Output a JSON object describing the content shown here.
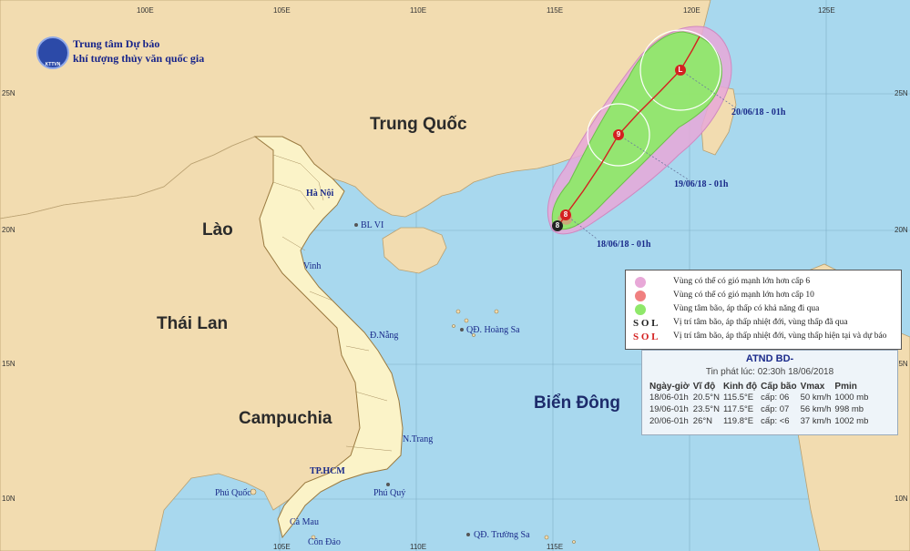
{
  "header": {
    "line1": "Trung tâm Dự báo",
    "line2": "khí tượng thủy văn quốc gia",
    "logo_text": "KTTVN"
  },
  "ticks": {
    "lon": [
      "100E",
      "105E",
      "110E",
      "115E",
      "120E",
      "125E"
    ],
    "lat": [
      "25N",
      "20N",
      "15N",
      "10N"
    ]
  },
  "countries": {
    "china": "Trung Quốc",
    "laos": "Lào",
    "thailand": "Thái Lan",
    "cambodia": "Campuchia"
  },
  "sea": "Biển Đông",
  "places": {
    "hanoi": "Hà Nội",
    "blvi": "BL VI",
    "vinh": "Vinh",
    "danang": "Đ.Nẵng",
    "hoangsa": "QĐ. Hoàng Sa",
    "nhatrang": "N.Trang",
    "hcm": "TP.HCM",
    "phuquoc": "Phú Quốc",
    "phuquy": "Phú Quý",
    "camau": "Cà Mau",
    "condao": "Côn Đảo",
    "truongsa": "QĐ. Trường Sa"
  },
  "forecast_labels": {
    "d1": "18/06/18 - 01h",
    "d2": "19/06/18 - 01h",
    "d3": "20/06/18 - 01h"
  },
  "storm_symbols": {
    "past": "8",
    "current": "8",
    "day2": "9",
    "day3": "L"
  },
  "legend": {
    "items": [
      {
        "text": "Vùng có thể có gió mạnh lớn hơn cấp 6",
        "color": "#e8a8d8"
      },
      {
        "text": "Vùng có thể có gió mạnh lớn hơn cấp 10",
        "color": "#f08080"
      },
      {
        "text": "Vùng tâm bão, áp thấp có khả năng đi qua",
        "color": "#8fe86a"
      },
      {
        "text": "Vị trí tâm bão, áp thấp nhiệt đới, vùng thấp đã qua",
        "color": "#222222"
      },
      {
        "text": "Vị trí tâm bão, áp thấp nhiệt đới, vùng thấp hiện tại và dự báo",
        "color": "#d42020"
      }
    ]
  },
  "info": {
    "title": "ATND BD-",
    "issued": "Tin phát lúc: 02:30h 18/06/2018",
    "columns": [
      "Ngày-giờ",
      "Vĩ độ",
      "Kinh độ",
      "Cấp bão",
      "Vmax",
      "Pmin"
    ],
    "rows": [
      [
        "18/06-01h",
        "20.5°N",
        "115.5°E",
        "cấp: 06",
        "50 km/h",
        "1000 mb"
      ],
      [
        "19/06-01h",
        "23.5°N",
        "117.5°E",
        "cấp: 07",
        "56 km/h",
        "998 mb"
      ],
      [
        "20/06-01h",
        "26°N",
        "119.8°E",
        "cấp: <6",
        "37 km/h",
        "1002 mb"
      ]
    ]
  },
  "colors": {
    "sea": "#a8d8ee",
    "land_vn": "#fbf3c8",
    "land_other": "#f2dcb0",
    "pink": "#e8a8d8",
    "green": "#8fe86a",
    "track": "#d42020"
  }
}
